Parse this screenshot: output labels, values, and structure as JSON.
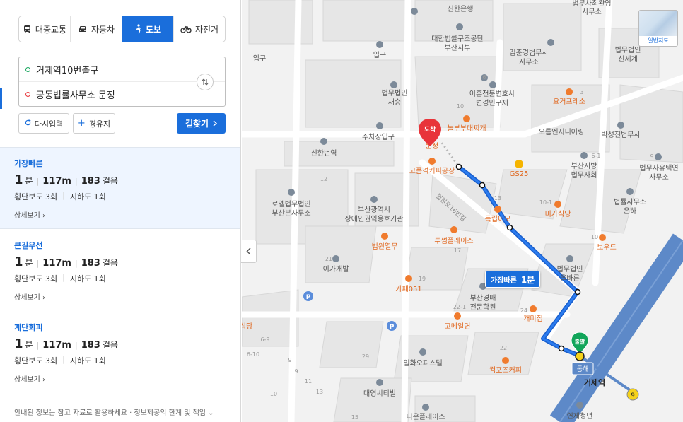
{
  "transport_modes": [
    {
      "label": "대중교통",
      "icon": "bus-icon",
      "active": false
    },
    {
      "label": "자동차",
      "icon": "car-icon",
      "active": false
    },
    {
      "label": "도보",
      "icon": "walk-icon",
      "active": true
    },
    {
      "label": "자전거",
      "icon": "bicycle-icon",
      "active": false
    }
  ],
  "origin": "거제역10번출구",
  "destination": "공동법률사무소 문정",
  "actions": {
    "reset": "다시입력",
    "waypoint": "경유지",
    "search": "길찾기"
  },
  "routes": [
    {
      "name": "가장빠른",
      "minutes": "1",
      "minutes_unit": "분",
      "distance": "117m",
      "steps": "183",
      "steps_unit": "걸음",
      "crosswalk": "횡단보도 3회",
      "underpass": "지하도 1회",
      "detail": "상세보기"
    },
    {
      "name": "큰길우선",
      "minutes": "1",
      "minutes_unit": "분",
      "distance": "117m",
      "steps": "183",
      "steps_unit": "걸음",
      "crosswalk": "횡단보도 3회",
      "underpass": "지하도 1회",
      "detail": "상세보기"
    },
    {
      "name": "계단회피",
      "minutes": "1",
      "minutes_unit": "분",
      "distance": "117m",
      "steps": "183",
      "steps_unit": "걸음",
      "crosswalk": "횡단보도 3회",
      "underpass": "지하도 1회",
      "detail": "상세보기"
    }
  ],
  "notice": "안내된 정보는 참고 자료로 활용하세요 · 정보제공의 한계 및 책임",
  "map": {
    "map_type_label": "일반지도",
    "route_label": {
      "name": "가장빠른",
      "time": "1분"
    },
    "start_marker": "출발",
    "end_marker": "도착",
    "station_name": "거제역",
    "station_exit": "동해",
    "exit_number": "9",
    "pois": {
      "shinhan_bank": "신한은행",
      "law_header": "법무사최완영",
      "law_header2": "사무소",
      "kepa": "대한법률구조공단",
      "kepa2": "부산지부",
      "kim_law": "김춘경법무사",
      "kim_law2": "사무소",
      "shinsegye": "법무법인",
      "shinsegye2": "신세계",
      "entrance_left": "입구",
      "entrance": "입구",
      "chaeseung": "법무법인",
      "chaeseung2": "채승",
      "divorce": "이혼전문변호사",
      "divorce2": "변경민구제",
      "yogurt": "요거프레소",
      "noble": "놀부부대찌개",
      "parking_entrance": "주차장입구",
      "orange": "오름엔지니어링",
      "baksung": "박성진법무사",
      "munjeong": "문정",
      "shinhan_station": "신한번역",
      "coffee": "고품격커피공장",
      "gs25": "GS25",
      "busan_judicial": "부산지방",
      "busan_judicial2": "법무사회",
      "law_yutaek": "법무사유택연",
      "law_yutaek2": "사무소",
      "road_name": "법원로16번길",
      "roel": "로엘법무법인",
      "roel2": "부산분사무소",
      "human_rights": "부산광역시",
      "human_rights2": "장애인권익옹호기관",
      "dokjeom": "독립이모",
      "migashikdang": "미가식당",
      "eunha": "법률사무소",
      "eunha2": "은하",
      "beopwon": "법원열무",
      "tusome": "투썸플레이스",
      "wood": "보우드",
      "igagaebal": "이가개발",
      "bareun": "법무법인",
      "bareun2": "올바른",
      "cafe051": "카페051",
      "gyeongmae": "부산경매",
      "gyeongmae2": "전문학원",
      "gomeil": "고메일면",
      "gaemi": "개미집",
      "dang": "식당",
      "office": "일화오피스텔",
      "compose": "컴포즈커피",
      "daeyoung": "대영씨티빌",
      "dion": "디온플레이스",
      "youth": "연제청년",
      "n12": "12",
      "n29": "29",
      "n13": "13",
      "n10a": "10",
      "n10b": "10",
      "n10c": "10",
      "n17": "17",
      "n19": "19",
      "n21": "21",
      "n22_1": "22-1",
      "n22": "22",
      "n24": "24",
      "n6": "6",
      "n3": "3",
      "n61": "6-1",
      "n9": "9",
      "n10_1": "10-1",
      "n69": "6-9",
      "n610": "6-10",
      "n9b": "9",
      "n11": "11",
      "n13b": "13",
      "n15": "15",
      "n9c": "9"
    }
  },
  "colors": {
    "accent": "#1a6edb",
    "route": "#1a6edb",
    "poi_orange": "#f07b2d",
    "poi_gray": "#7c8a99",
    "start_green": "#12a55a",
    "end_red": "#e8343a",
    "subway_line": "#5d89c8"
  }
}
